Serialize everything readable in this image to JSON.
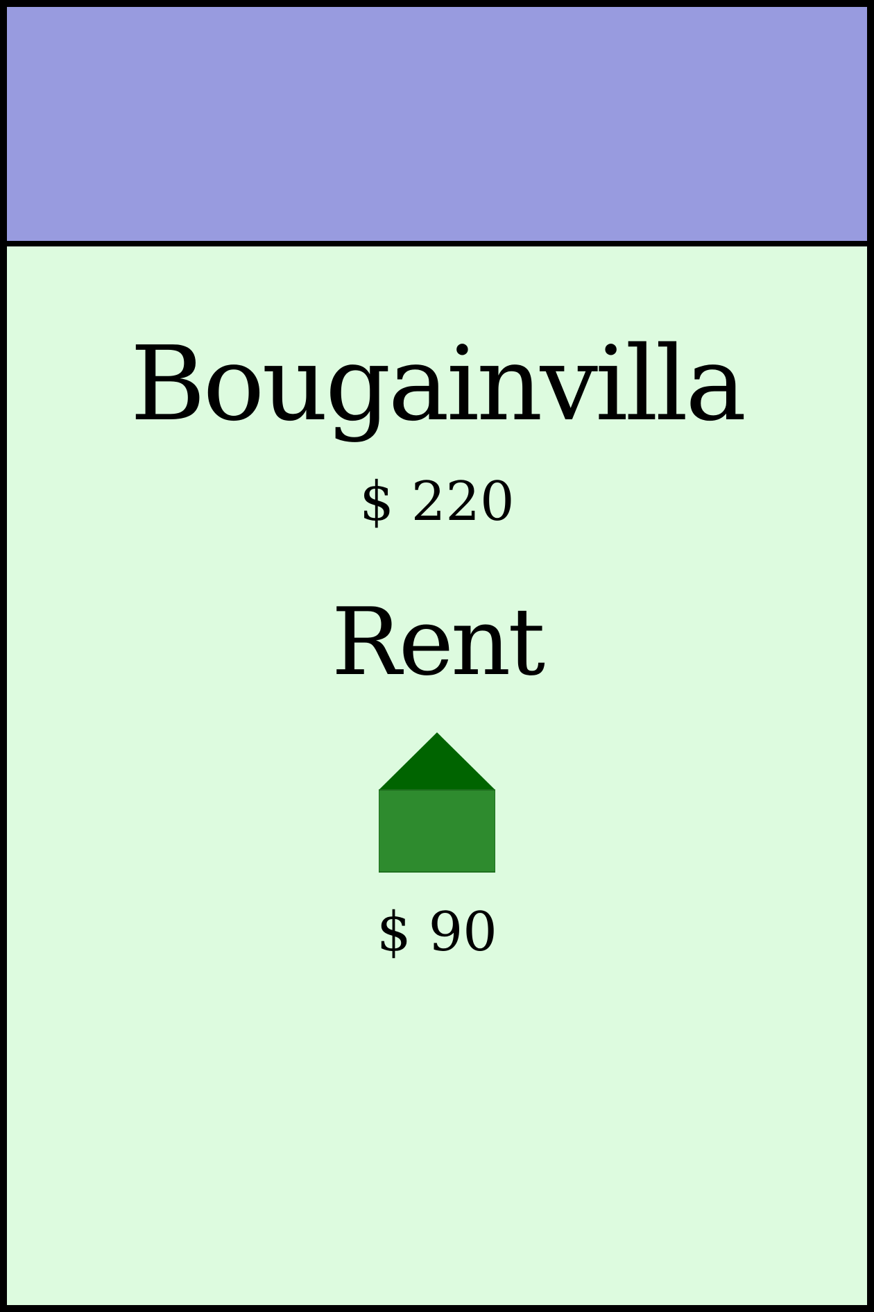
{
  "card": {
    "band_color": "#989bdf",
    "background_color": "#ddfbdf",
    "name": "Bougainvilla",
    "price": "$ 220",
    "rent_heading": "Rent",
    "house_icon": "house-icon",
    "house_roof_color": "#006400",
    "house_body_color": "#2e8b2e",
    "rent_value": "$ 90"
  }
}
